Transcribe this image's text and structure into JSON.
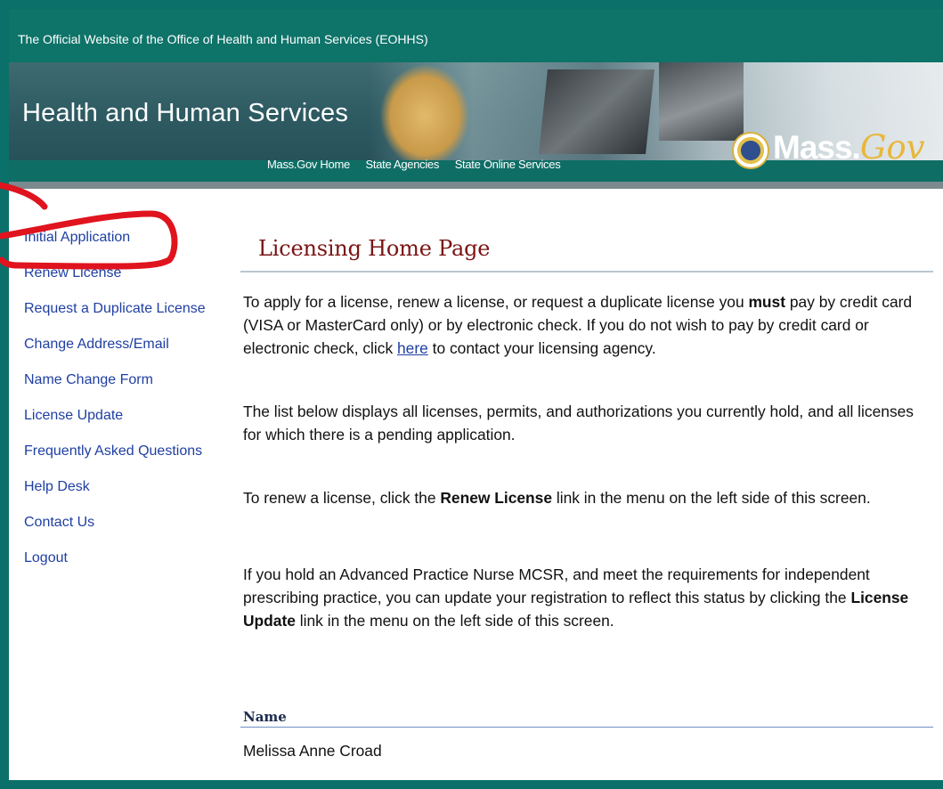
{
  "header": {
    "official_text": "The Official Website of the Office of Health and Human Services (EOHHS)",
    "title": "Health and Human Services",
    "nav": [
      "Mass.Gov Home",
      "State Agencies",
      "State Online Services"
    ],
    "logo_main": "Mass.",
    "logo_accent": "Gov"
  },
  "sidebar": {
    "items": [
      {
        "label": "Initial Application"
      },
      {
        "label": "Renew License"
      },
      {
        "label": "Request a Duplicate License"
      },
      {
        "label": "Change Address/Email"
      },
      {
        "label": "Name Change Form"
      },
      {
        "label": "License Update"
      },
      {
        "label": "Frequently Asked Questions"
      },
      {
        "label": "Help Desk"
      },
      {
        "label": "Contact Us"
      },
      {
        "label": "Logout"
      }
    ]
  },
  "main": {
    "title": "Licensing Home Page",
    "p1": {
      "a": "To apply for a license, renew a license, or request a duplicate license you ",
      "b": "must",
      "c": " pay by credit card (VISA or MasterCard only) or by electronic check. If you do not wish to pay by credit card or electronic check, click ",
      "link": "here",
      "d": " to contact your licensing agency."
    },
    "p2": "The list below displays all licenses, permits, and authorizations you currently hold, and all licenses for which there is a pending application.",
    "p3": {
      "a": "To renew a license, click the ",
      "b": "Renew License",
      "c": " link in the menu on the left side of this screen."
    },
    "p4": {
      "a": "If you hold an Advanced Practice Nurse MCSR, and meet the requirements for independent prescribing practice, you can update your registration to reflect this status by clicking the ",
      "b": "License Update",
      "c": " link in the menu on the left side of this screen."
    },
    "name_label": "Name",
    "name_value": "Melissa Anne Croad"
  },
  "colors": {
    "frame": "#0b7069",
    "link": "#1f3fa2",
    "title": "#7a1414",
    "annotation": "#e0141e"
  }
}
